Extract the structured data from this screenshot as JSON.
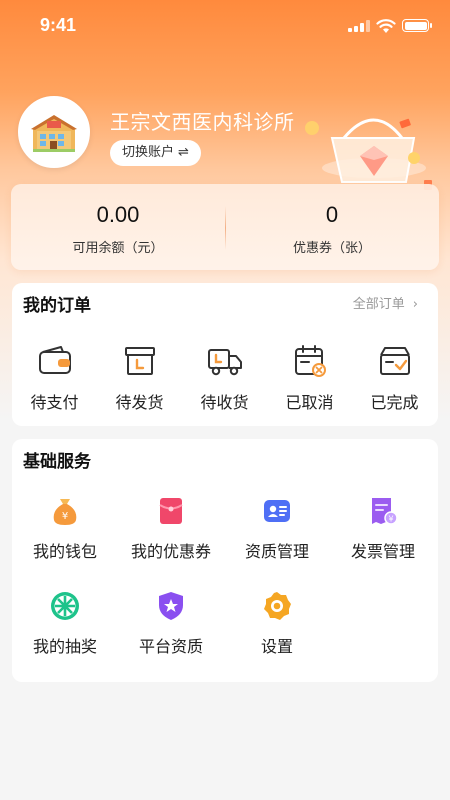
{
  "status_bar": {
    "time": "9:41"
  },
  "profile": {
    "shop_name": "王宗文西医内科诊所",
    "switch_label": "切换账户",
    "switch_arrow": "⇌"
  },
  "balance": {
    "available": {
      "value": "0.00",
      "label": "可用余额（元）"
    },
    "coupons": {
      "value": "0",
      "label": "优惠券（张）"
    }
  },
  "orders": {
    "title": "我的订单",
    "all_label": "全部订单",
    "chevron": "›",
    "items": [
      {
        "label": "待支付",
        "icon": "wallet-icon"
      },
      {
        "label": "待发货",
        "icon": "box-icon"
      },
      {
        "label": "待收货",
        "icon": "truck-icon"
      },
      {
        "label": "已取消",
        "icon": "calendar-cancel-icon"
      },
      {
        "label": "已完成",
        "icon": "box-check-icon"
      }
    ]
  },
  "services": {
    "title": "基础服务",
    "items": [
      {
        "label": "我的钱包",
        "icon": "money-bag-icon"
      },
      {
        "label": "我的优惠券",
        "icon": "coupon-icon"
      },
      {
        "label": "资质管理",
        "icon": "id-card-icon"
      },
      {
        "label": "发票管理",
        "icon": "invoice-icon"
      },
      {
        "label": "我的抽奖",
        "icon": "lottery-wheel-icon"
      },
      {
        "label": "平台资质",
        "icon": "shield-star-icon"
      },
      {
        "label": "设置",
        "icon": "gear-icon"
      }
    ]
  },
  "colors": {
    "brand_orange": "#ff8a3d",
    "icon_orange": "#f59a3c",
    "coupon_red": "#f0476a",
    "id_blue": "#4f6ff5",
    "invoice_purple": "#9b5cf0",
    "lottery_green": "#1ec38b",
    "shield_purple": "#8a4ff0",
    "gear_orange": "#f5a623"
  }
}
